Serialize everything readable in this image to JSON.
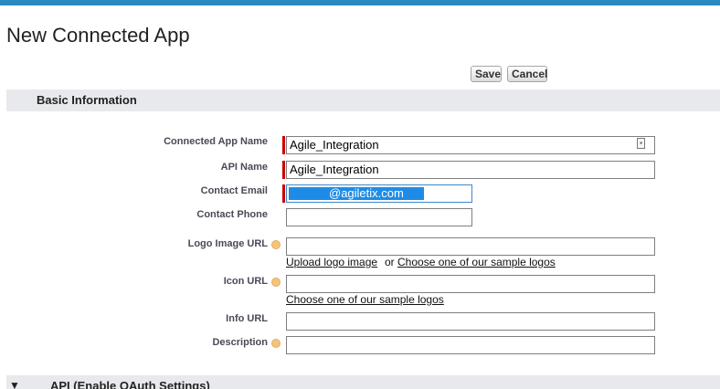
{
  "page": {
    "title": "New Connected App"
  },
  "toolbar": {
    "save_label": "Save",
    "cancel_label": "Cancel"
  },
  "sections": {
    "basic": {
      "title": "Basic Information"
    },
    "api": {
      "title": "API (Enable OAuth Settings)",
      "arrow": "▼"
    }
  },
  "fields": {
    "app_name": {
      "label": "Connected App Name",
      "value": "Agile_Integration"
    },
    "api_name": {
      "label": "API Name",
      "value": "Agile_Integration"
    },
    "contact_email": {
      "label": "Contact Email",
      "value": "@agiletix.com"
    },
    "contact_phone": {
      "label": "Contact Phone",
      "value": ""
    },
    "logo_url": {
      "label": "Logo Image URL",
      "value": "",
      "upload_link": "Upload logo image",
      "or_text": "or",
      "sample_link": "Choose one of our sample logos"
    },
    "icon_url": {
      "label": "Icon URL",
      "value": "",
      "sample_link": "Choose one of our sample logos"
    },
    "info_url": {
      "label": "Info URL",
      "value": ""
    },
    "description": {
      "label": "Description",
      "value": ""
    }
  },
  "colors": {
    "topbar": "#2a8ac0",
    "required": "#cc0000",
    "selection": "#1e8ce6",
    "section_bg": "#e8e9ec"
  }
}
